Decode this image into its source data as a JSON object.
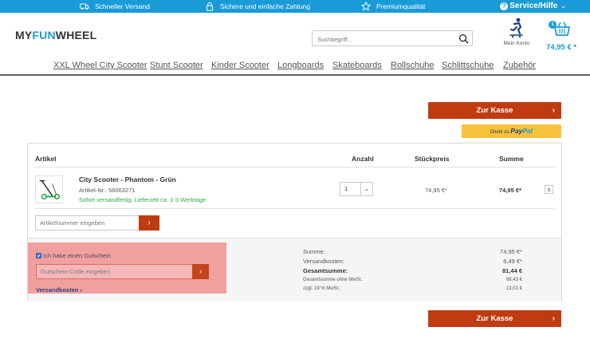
{
  "topbar": {
    "shipping": "Schneller Versand",
    "payment": "Sichere und einfache Zahlung",
    "quality": "Premiumqualität",
    "help": "Service/Hilfe",
    "help_chevron": "⌄"
  },
  "logo": {
    "part1": "MY",
    "part2": "FUN",
    "part3": "WHEEL"
  },
  "search": {
    "placeholder": "Suchbegriff..."
  },
  "account": {
    "label": "Mein Konto"
  },
  "cart": {
    "count": "1",
    "total": "74,95 € *"
  },
  "nav": {
    "items": [
      {
        "label": "XXL Wheel City Scooter"
      },
      {
        "label": "Stunt Scooter"
      },
      {
        "label": "Kinder Scooter"
      },
      {
        "label": "Longboards"
      },
      {
        "label": "Skateboards"
      },
      {
        "label": "Rollschuhe"
      },
      {
        "label": "Schlittschuhe"
      },
      {
        "label": "Zubehör"
      }
    ]
  },
  "checkout": {
    "label": "Zur Kasse",
    "arrow": "›"
  },
  "paypal": {
    "prefix": "Direkt zu",
    "brand1": "Pay",
    "brand2": "Pal"
  },
  "table": {
    "headers": {
      "article": "Artikel",
      "qty": "Anzahl",
      "unit_price": "Stückpreis",
      "sum": "Summe"
    },
    "item": {
      "name": "City Scooter - Phantom - Grün",
      "article_no": "Artikel-Nr.: 56063271",
      "shipping": "Sofort versandfertig, Lieferzeit ca. 1-3 Werktage",
      "qty": "1",
      "qty_chevron": "⌄",
      "unit_price": "74,95 €*",
      "sum": "74,95 €*",
      "remove": "x"
    },
    "add_article": {
      "placeholder": "Artikelnummer eingeben",
      "button": "›"
    }
  },
  "voucher": {
    "checkbox_label": "Ich habe einen Gutschein",
    "placeholder": "Gutschein-Code eingeben",
    "button": "›",
    "shipping_link": "Versandkosten ›"
  },
  "summary": {
    "subtotal_label": "Summe:",
    "subtotal": "74,95 €*",
    "shipping_label": "Versandkosten:",
    "shipping": "6,49 €*",
    "total_label": "Gesamtsumme:",
    "total": "81,44 €",
    "net_label": "Gesamtsumme ohne MwSt.:",
    "net": "68,43 €",
    "vat_label": "zzgl. 19 % MwSt.:",
    "vat": "13,01 €"
  },
  "colors": {
    "brand_blue": "#1a9bd7",
    "checkout_red": "#c13b10",
    "paypal_yellow": "#f7c23b",
    "in_stock_green": "#2ea84a"
  }
}
